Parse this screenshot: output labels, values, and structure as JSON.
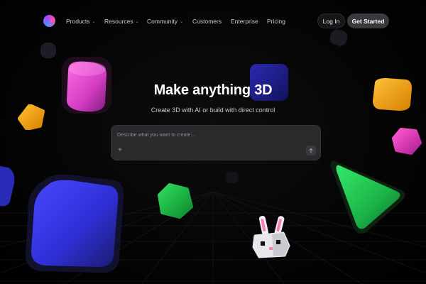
{
  "header": {
    "logo": "gradient-orb-logo",
    "nav": [
      {
        "label": "Products",
        "has_dropdown": true
      },
      {
        "label": "Resources",
        "has_dropdown": true
      },
      {
        "label": "Community",
        "has_dropdown": true
      },
      {
        "label": "Customers",
        "has_dropdown": false
      },
      {
        "label": "Enterprise",
        "has_dropdown": false
      },
      {
        "label": "Pricing",
        "has_dropdown": false
      }
    ],
    "login_label": "Log In",
    "cta_label": "Get Started"
  },
  "hero": {
    "title": "Make anything 3D",
    "subtitle": "Create 3D with AI or build with direct control",
    "prompt_placeholder": "Describe what you want to create...",
    "add_icon": "plus-icon",
    "send_icon": "arrow-up-icon"
  },
  "colors": {
    "background": "#000000",
    "magenta": "#e640c8",
    "navy": "#1e1e88",
    "orange": "#f5a20a",
    "green": "#1fc24a",
    "pink": "#e23fb4",
    "blue": "#3d3dff"
  }
}
